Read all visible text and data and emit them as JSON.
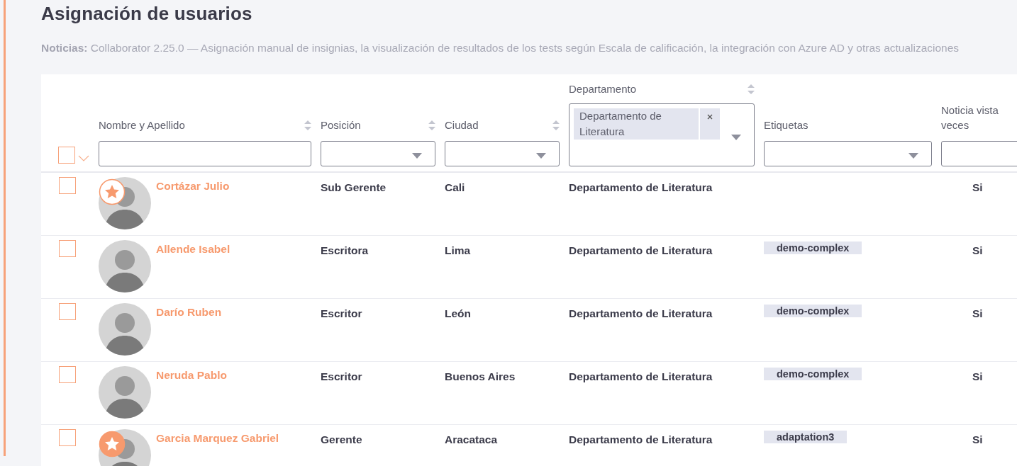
{
  "page": {
    "title": "Asignación de usuarios",
    "news_label": "Noticias:",
    "news_text": "Collaborator 2.25.0 — Asignación manual de insignias, la visualización de resultados de los tests según Escala de calificación, la integración con Azure AD y otras actualizaciones"
  },
  "table": {
    "select_all": {
      "checked": false
    },
    "columns": [
      {
        "label": "Nombre y Apellido",
        "kind": "text",
        "sortable": true
      },
      {
        "label": "Posición",
        "kind": "select",
        "sortable": true
      },
      {
        "label": "Ciudad",
        "kind": "select",
        "sortable": true
      },
      {
        "label": "Departamento",
        "kind": "multi",
        "sortable": true,
        "chips": [
          "Departamento de Literatura"
        ]
      },
      {
        "label": "Etiquetas",
        "kind": "select",
        "sortable": false
      },
      {
        "label": "Noticia vista veces",
        "kind": "select",
        "sortable": false
      }
    ],
    "rows": [
      {
        "checked": false,
        "badge": {
          "kind": "outline"
        },
        "name": "Cortázar Julio",
        "position": "Sub Gerente",
        "city": "Cali",
        "department": "Departamento de Literatura",
        "tag": null,
        "seen": "Si"
      },
      {
        "checked": false,
        "name": "Allende Isabel",
        "position": "Escritora",
        "city": "Lima",
        "department": "Departamento de Literatura",
        "tag": "demo-complex",
        "seen": "Si"
      },
      {
        "checked": false,
        "name": "Darío Ruben",
        "position": "Escritor",
        "city": "León",
        "department": "Departamento de Literatura",
        "tag": "demo-complex",
        "seen": "Si"
      },
      {
        "checked": false,
        "name": "Neruda Pablo",
        "position": "Escritor",
        "city": "Buenos Aires",
        "department": "Departamento de Literatura",
        "tag": "demo-complex",
        "seen": "Si"
      },
      {
        "checked": false,
        "badge": {
          "kind": "filled"
        },
        "name": "Garcia Marquez Gabriel",
        "position": "Gerente",
        "city": "Aracataca",
        "department": "Departamento de Literatura",
        "tag": "adaptation3",
        "seen": "Si"
      }
    ]
  }
}
